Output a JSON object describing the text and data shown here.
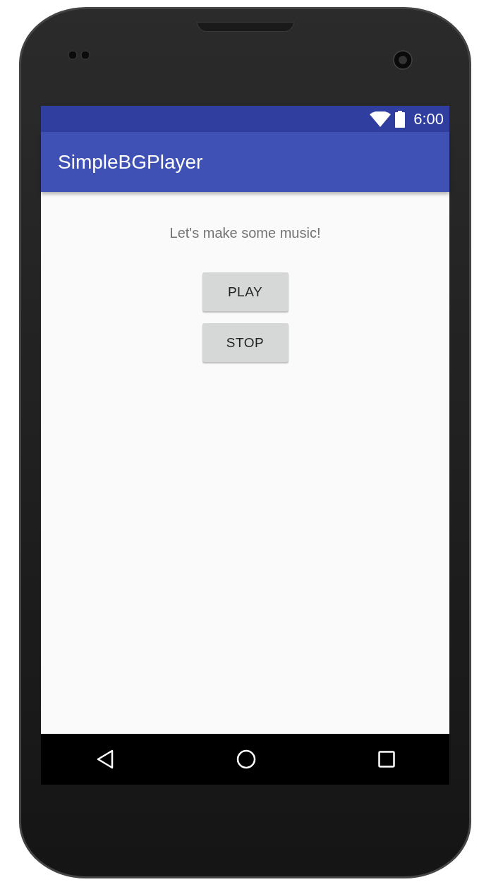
{
  "status_bar": {
    "time": "6:00"
  },
  "app_bar": {
    "title": "SimpleBGPlayer"
  },
  "content": {
    "message": "Let's make some music!",
    "buttons": [
      "PLAY",
      "STOP"
    ]
  }
}
